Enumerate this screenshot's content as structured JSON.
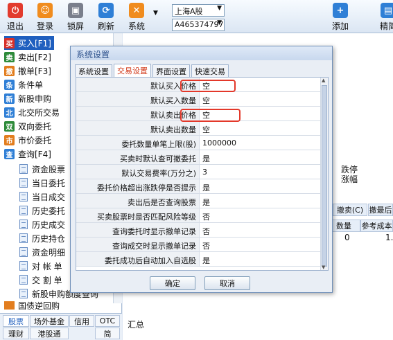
{
  "toolbar": {
    "buttons": [
      {
        "label": "退出",
        "icon": "power-icon",
        "color": "#e23b2e"
      },
      {
        "label": "登录",
        "icon": "user-login-icon",
        "color": "#f08c1e"
      },
      {
        "label": "锁屏",
        "icon": "lock-icon",
        "color": "#7a7f8c"
      },
      {
        "label": "刷新",
        "icon": "refresh-icon",
        "color": "#2f7fd6"
      },
      {
        "label": "系统",
        "icon": "tools-icon",
        "color": "#f08c1e"
      },
      {
        "label": "添加",
        "icon": "add-user-icon",
        "color": "#2f7fd6"
      },
      {
        "label": "精简",
        "icon": "compact-icon",
        "color": "#2f7fd6"
      }
    ],
    "market_select": "上海A股",
    "account_select": "A465374797"
  },
  "nav": {
    "items": [
      {
        "label": "买入[F1]",
        "badge": "买",
        "color": "#d7302a"
      },
      {
        "label": "卖出[F2]",
        "badge": "卖",
        "color": "#2e8b3a"
      },
      {
        "label": "撤单[F3]",
        "badge": "撤",
        "color": "#e27d1e"
      },
      {
        "label": "条件单",
        "badge": "条",
        "color": "#2f7fd6"
      },
      {
        "label": "新股申购",
        "badge": "新",
        "color": "#2f7fd6"
      },
      {
        "label": "北交所交易",
        "badge": "北",
        "color": "#2f7fd6"
      },
      {
        "label": "双向委托",
        "badge": "双",
        "color": "#2e8b3a"
      },
      {
        "label": "市价委托",
        "badge": "市",
        "color": "#e27d1e"
      },
      {
        "label": "查询[F4]",
        "badge": "查",
        "color": "#2f7fd6"
      }
    ],
    "subitems": [
      "资金股票",
      "当日委托",
      "当日成交",
      "历史委托",
      "历史成交",
      "历史持仓",
      "资金明细",
      "对 帐 单",
      "交 割 单",
      "新股申购额度查询"
    ],
    "partial_item": "国债逆回购",
    "bottom_tabs_row1": [
      "股票",
      "场外基金",
      "信用",
      "OTC"
    ],
    "bottom_tabs_row2": [
      "理财",
      "港股通",
      "简"
    ]
  },
  "background": {
    "fragments": [
      "跌停",
      "涨幅",
      "撤卖(C)",
      "撤最后",
      "数量",
      "参考成本",
      "0",
      "1.",
      "汇总"
    ]
  },
  "dialog": {
    "title": "系统设置",
    "tabs": [
      "系统设置",
      "交易设置",
      "界面设置",
      "快速交易"
    ],
    "active_tab": "交易设置",
    "rows": [
      {
        "key": "默认买入价格",
        "value": "空"
      },
      {
        "key": "默认买入数量",
        "value": "空"
      },
      {
        "key": "默认卖出价格",
        "value": "空"
      },
      {
        "key": "默认卖出数量",
        "value": "空"
      },
      {
        "key": "委托数量单笔上限(股)",
        "value": "1000000"
      },
      {
        "key": "买卖时默认查可撤委托",
        "value": "是"
      },
      {
        "key": "默认交易费率(万分之)",
        "value": "3"
      },
      {
        "key": "委托价格超出涨跌停是否提示",
        "value": "是"
      },
      {
        "key": "卖出后是否查询股票",
        "value": "是"
      },
      {
        "key": "买卖股票时是否匹配风险等级",
        "value": "否"
      },
      {
        "key": "查询委托时显示撤单记录",
        "value": "否"
      },
      {
        "key": "查询成交时显示撤单记录",
        "value": "否"
      },
      {
        "key": "委托成功后自动加入自选股",
        "value": "是"
      }
    ],
    "ok_label": "确定",
    "cancel_label": "取消",
    "highlight_color": "#e3382a"
  }
}
